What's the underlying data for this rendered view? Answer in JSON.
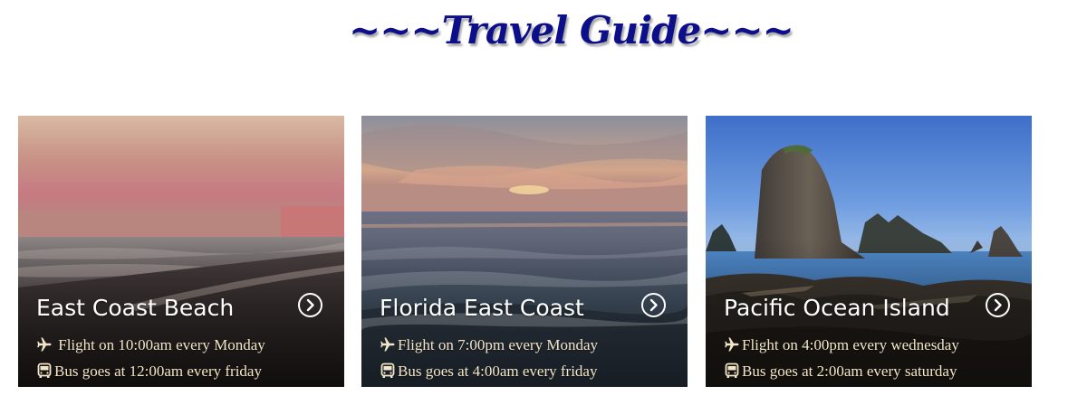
{
  "header": {
    "title": "~~~Travel Guide~~~"
  },
  "cards": [
    {
      "title": "East Coast Beach",
      "flight": " Flight on 10:00am every Monday",
      "bus": "Bus goes at 12:00am every friday",
      "scene": "pink-sunset-beach"
    },
    {
      "title": "Florida East Coast",
      "flight": "Flight on 7:00pm every Monday",
      "bus": "Bus goes at 4:00am every friday",
      "scene": "ocean-sunset-waves"
    },
    {
      "title": "Pacific Ocean Island",
      "flight": "Flight on 4:00pm every wednesday",
      "bus": "Bus goes at 2:00am every saturday",
      "scene": "sea-stacks-blue-sky"
    }
  ],
  "icons": {
    "flight": "airplane-icon",
    "bus": "bus-icon",
    "more": "chevron-right-circle-icon"
  },
  "colors": {
    "title": "#0d0f8a",
    "card_text": "#ffffff",
    "info_text": "#f3e6c8"
  }
}
